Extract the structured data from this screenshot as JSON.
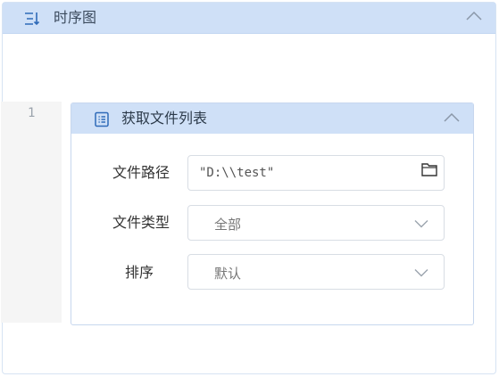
{
  "panel": {
    "title": "时序图",
    "icon": "sequence-list-icon"
  },
  "gutter": {
    "line_number": "1"
  },
  "step": {
    "title": "获取文件列表",
    "icon": "document-list-icon",
    "fields": {
      "path": {
        "label": "文件路径",
        "value": "\"D:\\\\test\"",
        "icon": "folder-icon"
      },
      "type": {
        "label": "文件类型",
        "value": "全部"
      },
      "sort": {
        "label": "排序",
        "value": "默认"
      }
    }
  },
  "colors": {
    "header_bg": "#cfe0f7",
    "border": "#c7d7ee",
    "accent": "#2f6ab8"
  }
}
